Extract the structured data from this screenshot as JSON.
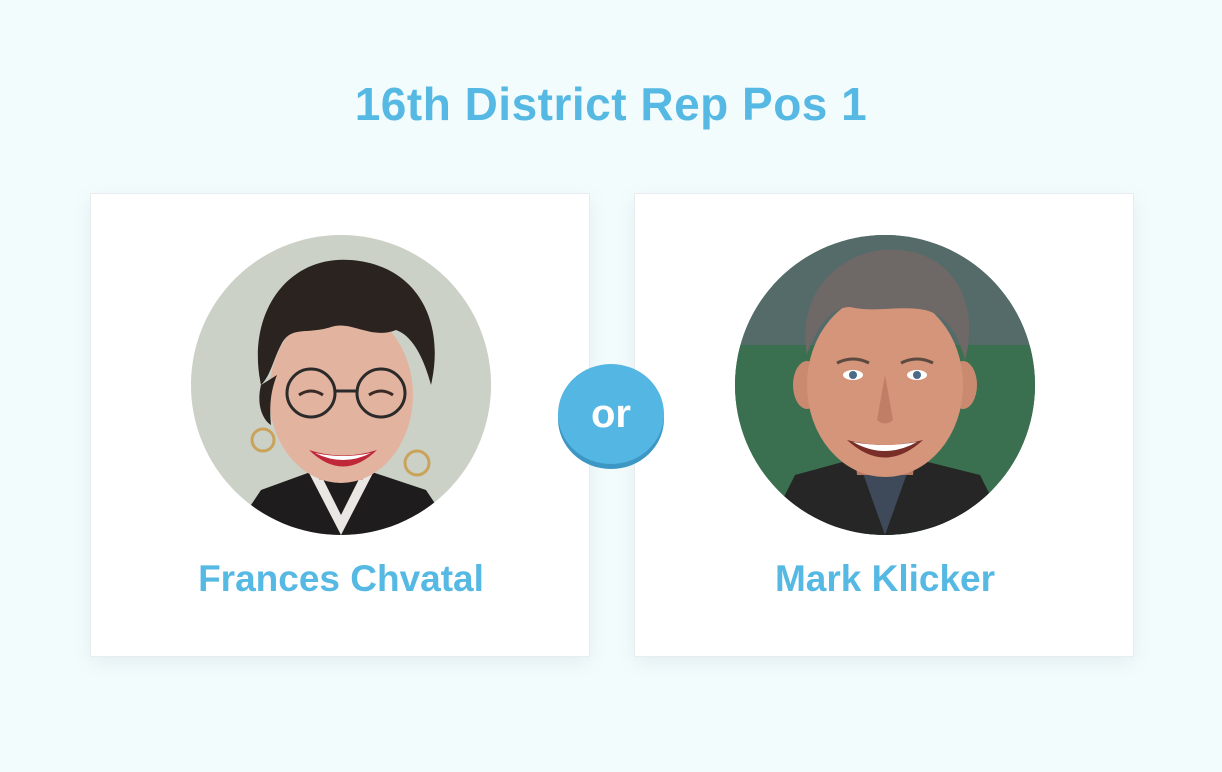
{
  "page": {
    "title": "16th District Rep Pos 1",
    "separator": "or"
  },
  "candidates": [
    {
      "name": "Frances Chvatal",
      "photo_icon": "candidate-photo-woman-glasses"
    },
    {
      "name": "Mark Klicker",
      "photo_icon": "candidate-photo-man-smiling"
    }
  ],
  "colors": {
    "accent": "#56b9e3",
    "background": "#f3fcfd",
    "card": "#ffffff"
  }
}
